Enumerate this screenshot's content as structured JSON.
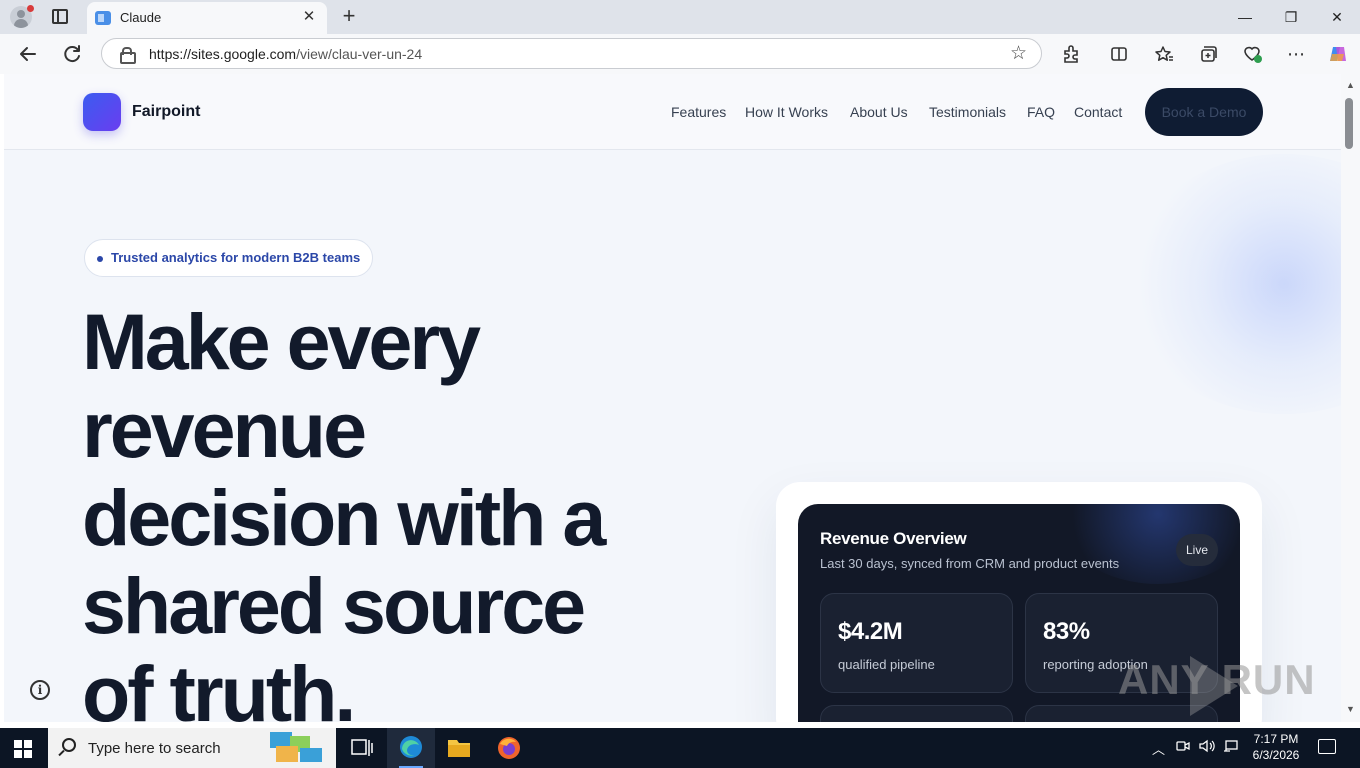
{
  "browser": {
    "tab_title": "Claude",
    "close_symbol": "✕",
    "new_tab_symbol": "+",
    "url_domain": "https://sites.google.com",
    "url_path": "/view/clau-ver-un-24",
    "window_controls": {
      "minimize": "—",
      "restore": "❐",
      "close": "✕"
    }
  },
  "site": {
    "brand": "Fairpoint",
    "nav": [
      "Features",
      "How It Works",
      "About Us",
      "Testimonials",
      "FAQ",
      "Contact"
    ],
    "cta": "Book a Demo",
    "badge": "Trusted analytics for modern B2B teams",
    "hero_title": "Make every revenue decision with a shared source of truth.",
    "info_symbol": "i"
  },
  "dashboard": {
    "title": "Revenue Overview",
    "subtitle": "Last 30 days, synced from CRM and product events",
    "status": "Live",
    "metrics": [
      {
        "value": "$4.2M",
        "label": "qualified pipeline"
      },
      {
        "value": "83%",
        "label": "reporting adoption"
      }
    ]
  },
  "watermark": "ANY RUN",
  "taskbar": {
    "search_placeholder": "Type here to search",
    "time": "7:17 PM",
    "date": "6/3/2026"
  },
  "colors": {
    "brand_gradient_start": "#3b5cf0",
    "brand_gradient_end": "#6a3df0",
    "cta_bg": "#0f1c33",
    "hero_text": "#121a2b",
    "card_bg": "#121827",
    "badge_text": "#2b47a8"
  }
}
